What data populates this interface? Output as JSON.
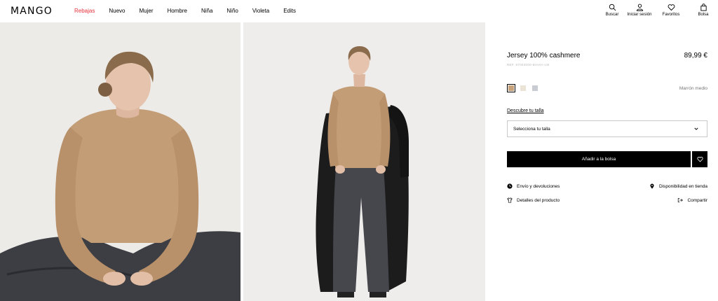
{
  "brand": {
    "logo": "MANGO"
  },
  "nav": [
    "Rebajas",
    "Nuevo",
    "Mujer",
    "Hombre",
    "Niña",
    "Niño",
    "Violeta",
    "Edits"
  ],
  "tools": {
    "search": "Buscar",
    "login": "Iniciar sesión",
    "favorites": "Favoritos",
    "bag": "Bolsa"
  },
  "product": {
    "title": "Jersey 100% cashmere",
    "price": "89,99 €",
    "ref": "REF. 67003000-BAHIA-LM",
    "color_name": "Marrón medio",
    "swatches": [
      "#c8a27a",
      "#e9e4d6",
      "#c9ccd2"
    ],
    "size_link": "Descubre tu talla",
    "size_placeholder": "Selecciona tu talla",
    "add_to_bag": "Añadir a la bolsa"
  },
  "links": {
    "shipping": "Envío y devoluciones",
    "store": "Disponibilidad en tienda",
    "details": "Detalles del producto",
    "share": "Compartir"
  },
  "colors": {
    "sale": "#e5313a",
    "sweater": "#c39d76",
    "jeans": "#3c3e44",
    "coat": "#1c1c1c"
  }
}
